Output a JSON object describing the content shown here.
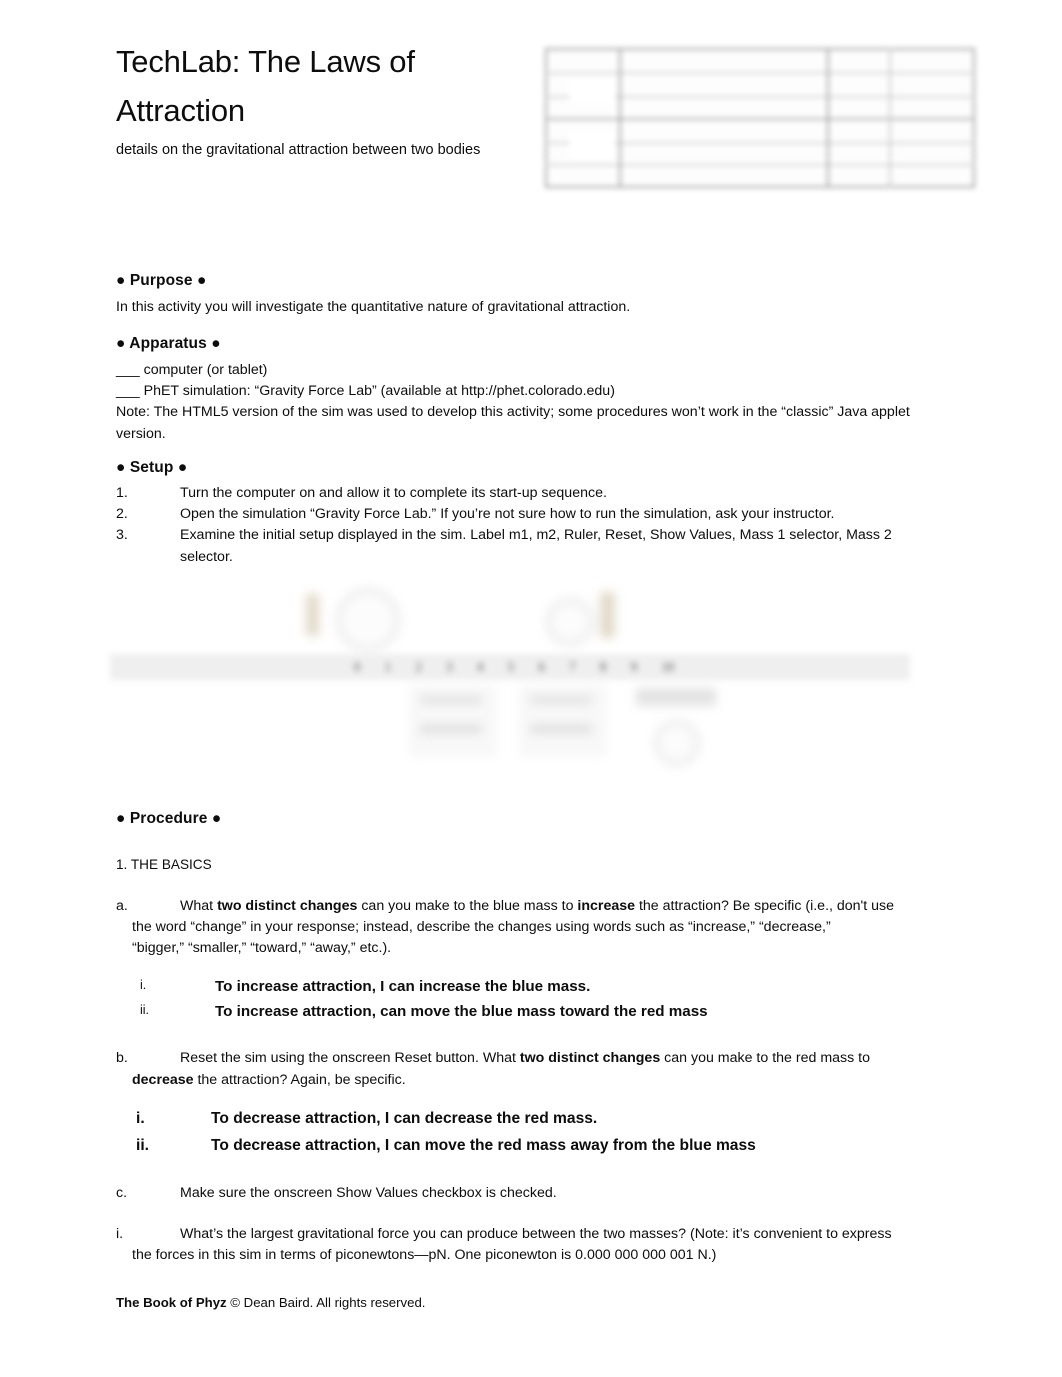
{
  "document": {
    "title": "TechLab: The Laws of Attraction",
    "subtitle": "details on the gravitational attraction between two bodies"
  },
  "sections": {
    "purpose": {
      "heading": "● Purpose ●",
      "body": "In this activity you will investigate the quantitative nature of gravitational attraction."
    },
    "apparatus": {
      "heading": "● Apparatus ●",
      "items": [
        "___ computer (or tablet)",
        "___ PhET simulation: “Gravity Force Lab” (available at http://phet.colorado.edu)"
      ],
      "note": "Note: The HTML5 version of the sim was used to develop this activity; some procedures won’t work in the “classic” Java applet version."
    },
    "setup": {
      "heading": "● Setup ●",
      "steps": [
        {
          "marker": "1.",
          "text": "Turn the computer on and allow it to complete its start-up sequence."
        },
        {
          "marker": "2.",
          "text": "Open the simulation “Gravity Force Lab.” If you’re not sure how to run the simulation, ask your instructor."
        },
        {
          "marker": "3.",
          "text": "Examine the initial setup displayed in the sim. Label m1, m2, Ruler, Reset, Show Values, Mass 1 selector, Mass 2 selector."
        }
      ]
    },
    "procedure": {
      "heading": "● Procedure ●",
      "subheading": "1. THE BASICS",
      "item_a": {
        "marker": "a.",
        "line1_pre": "What ",
        "line1_b1": "two distinct changes",
        "line1_mid": " can you make to the blue mass to ",
        "line1_b2": "increase",
        "line1_post": " the attraction? Be specific (i.e., don't use",
        "line2": "the word “change” in your response; instead, describe the changes using words such as “increase,” “decrease,”",
        "line3": "“bigger,” “smaller,” “toward,” “away,” etc.).",
        "answers": [
          {
            "marker": "i.",
            "text": "To increase attraction, I can increase the blue mass."
          },
          {
            "marker": "ii.",
            "text": "To increase attraction,  can move the blue mass toward the red mass"
          }
        ]
      },
      "item_b": {
        "marker": "b.",
        "line1_pre": "Reset the sim using the onscreen Reset button. What ",
        "line1_b1": "two distinct changes",
        "line1_post": " can you make to the red mass to",
        "line2_b": "decrease",
        "line2_post": " the attraction? Again, be specific.",
        "answers": [
          {
            "marker": "i.",
            "text": "To decrease attraction, I can decrease the red mass."
          },
          {
            "marker": "ii.",
            "text": "To decrease attraction, I can move the red mass away from the blue mass"
          }
        ]
      },
      "item_c": {
        "marker": "c.",
        "text": "Make sure the onscreen Show Values checkbox is checked."
      },
      "item_i": {
        "marker": "i.",
        "line1": "What’s the largest gravitational force you can produce between the two masses? (Note: it’s convenient to express",
        "line2": "the forces in this sim in terms of piconewtons—pN. One piconewton is 0.000 000 000 001 N.)"
      }
    }
  },
  "sim_graphic": {
    "ruler_ticks": [
      "0",
      "1",
      "2",
      "3",
      "4",
      "5",
      "6",
      "7",
      "8",
      "9",
      "10"
    ]
  },
  "footer": {
    "brand": "The Book of Phyz",
    "copyright": " © Dean Baird. All rights reserved."
  },
  "colors": {
    "text": "#0d0d0d",
    "page_bg": "#ffffff",
    "graphic_gray": "#d9d9d9",
    "mass_tan": "#cbbb9c"
  }
}
